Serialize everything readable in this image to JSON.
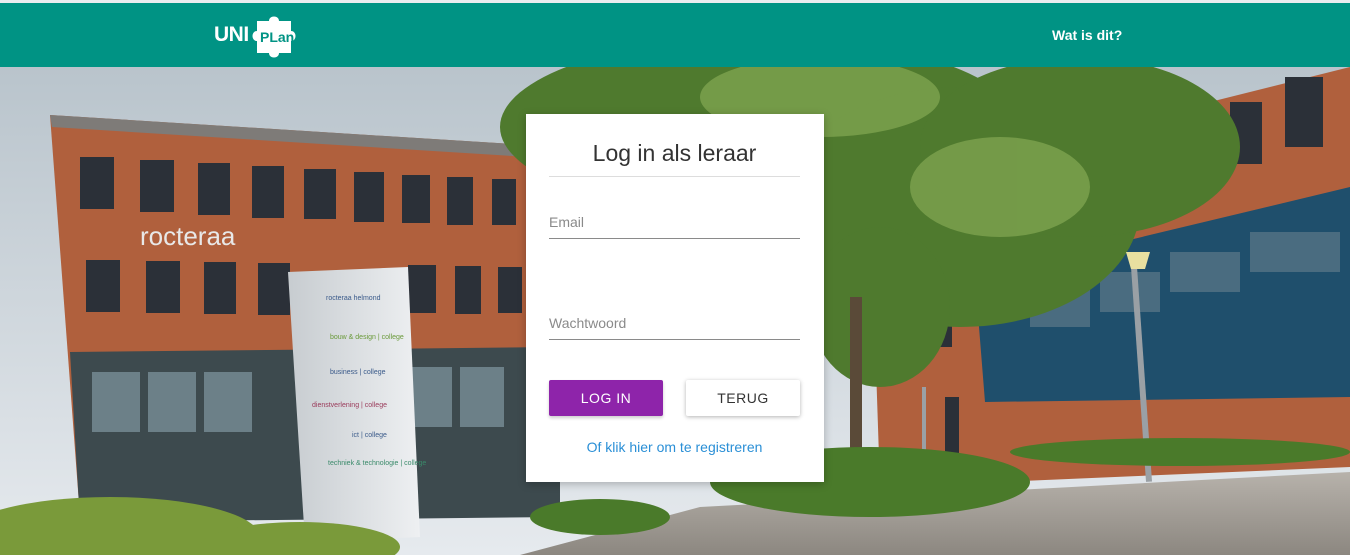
{
  "header": {
    "logo_text": "UNIPLan",
    "nav_link": "Wat is dit?"
  },
  "background": {
    "building_sign": "rocteraa",
    "totem_lines": [
      "rocteraa helmond",
      "bouw & design | college",
      "business | college",
      "dienstverlening | college",
      "ict | college",
      "techniek & technologie | college"
    ]
  },
  "login_card": {
    "title": "Log in als leraar",
    "email_placeholder": "Email",
    "password_placeholder": "Wachtwoord",
    "login_button": "LOG IN",
    "back_button": "TERUG",
    "register_link": "Of klik hier om te registreren"
  },
  "colors": {
    "navbar": "#009384",
    "login_button": "#8e24aa",
    "link": "#2a8fd6"
  }
}
